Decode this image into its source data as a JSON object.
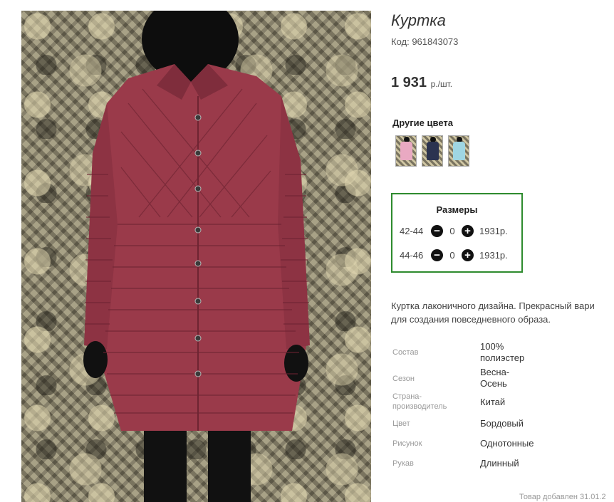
{
  "product": {
    "title": "Куртка",
    "code": "Код: 961843073",
    "price": "1 931",
    "price_unit": "р./шт."
  },
  "other_colors": {
    "label": "Другие цвета",
    "items": [
      {
        "name": "pink",
        "color": "#e9a9c2"
      },
      {
        "name": "navy",
        "color": "#2b3350"
      },
      {
        "name": "light-blue",
        "color": "#9fd6e3"
      }
    ]
  },
  "sizes": {
    "title": "Размеры",
    "rows": [
      {
        "size": "42-44",
        "qty": "0",
        "price": "1931р."
      },
      {
        "size": "44-46",
        "qty": "0",
        "price": "1931р."
      }
    ]
  },
  "description": {
    "line1": "Куртка лаконичного дизайна. Прекрасный вари",
    "line2": "для создания повседневного образа."
  },
  "properties": [
    {
      "label": "Состав",
      "value_lines": [
        "100%",
        "полиэстер"
      ]
    },
    {
      "label": "Сезон",
      "value_lines": [
        "Весна-",
        "Осень"
      ]
    },
    {
      "label_lines": [
        "Страна-",
        "производитель"
      ],
      "value_lines": [
        "Китай"
      ]
    },
    {
      "label": "Цвет",
      "value_lines": [
        "Бордовый"
      ]
    },
    {
      "label": "Рисунок",
      "value_lines": [
        "Однотонные"
      ]
    },
    {
      "label": "Рукав",
      "value_lines": [
        "Длинный"
      ]
    }
  ],
  "added_text": "Товар добавлен 31.01.2",
  "colors": {
    "accent_border": "#2e8b2e",
    "coat": "#9a3a4a"
  }
}
